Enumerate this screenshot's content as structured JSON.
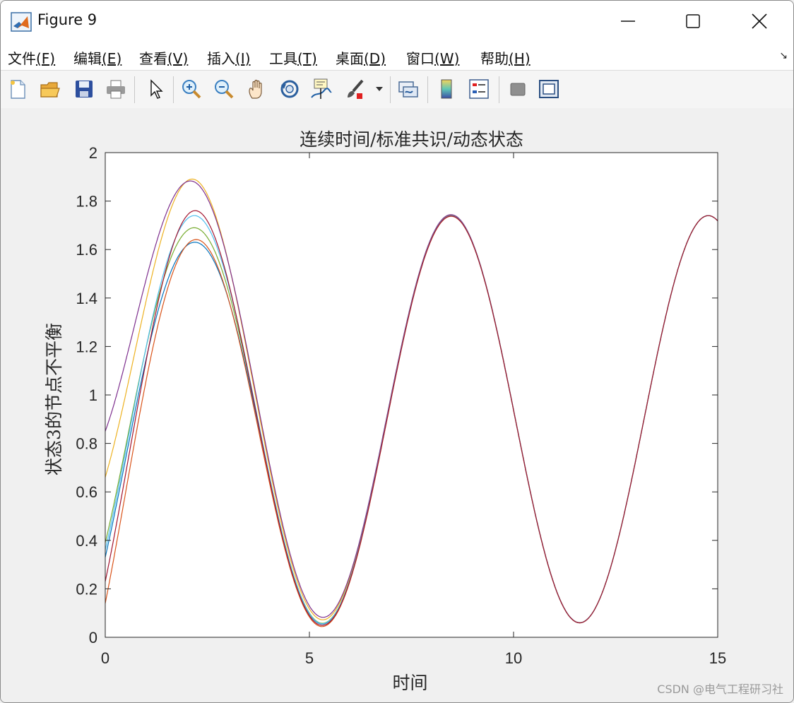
{
  "window": {
    "title": "Figure 9"
  },
  "menu": [
    {
      "label": "文件",
      "mnemonic": "(F)"
    },
    {
      "label": "编辑",
      "mnemonic": "(E)"
    },
    {
      "label": "查看",
      "mnemonic": "(V)"
    },
    {
      "label": "插入",
      "mnemonic": "(I)"
    },
    {
      "label": "工具",
      "mnemonic": "(T)"
    },
    {
      "label": "桌面",
      "mnemonic": "(D)"
    },
    {
      "label": "窗口",
      "mnemonic": "(W)"
    },
    {
      "label": "帮助",
      "mnemonic": "(H)"
    }
  ],
  "menu_overflow_icon": "↘",
  "toolbar": {
    "buttons": [
      "new-figure-icon",
      "open-file-icon",
      "save-icon",
      "print-icon",
      "arrow-cursor-icon",
      "zoom-in-icon",
      "zoom-out-icon",
      "pan-hand-icon",
      "rotate-3d-icon",
      "data-cursor-icon",
      "brush-icon",
      "link-plot-icon",
      "colorbar-icon",
      "legend-icon",
      "hide-plot-tools-icon",
      "show-plot-tools-icon"
    ]
  },
  "watermark": "CSDN @电气工程研习社",
  "chart_data": {
    "type": "line",
    "title": "连续时间/标准共识/动态状态",
    "xlabel": "时间",
    "ylabel": "状态3的节点不平衡",
    "xlim": [
      0,
      15
    ],
    "ylim": [
      0,
      2
    ],
    "xticks": [
      0,
      5,
      10,
      15
    ],
    "yticks": [
      0,
      0.2,
      0.4,
      0.6,
      0.8,
      1,
      1.2,
      1.4,
      1.6,
      1.8,
      2
    ],
    "xtick_labels": [
      "0",
      "5",
      "10",
      "15"
    ],
    "ytick_labels": [
      "0",
      "0.2",
      "0.4",
      "0.6",
      "0.8",
      "1",
      "1.2",
      "1.4",
      "1.6",
      "1.8",
      "2"
    ],
    "grid": false,
    "consensus": {
      "offset": 0.9,
      "amplitude": 0.84,
      "period": 6.3,
      "first_min_t": 5.32
    },
    "series": [
      {
        "color": "#0072BD",
        "initial": 0.33,
        "first_peak": 1.63
      },
      {
        "color": "#D95319",
        "initial": 0.14,
        "first_peak": 1.64
      },
      {
        "color": "#EDB120",
        "initial": 0.66,
        "first_peak": 1.89
      },
      {
        "color": "#7E2F8E",
        "initial": 0.85,
        "first_peak": 1.88
      },
      {
        "color": "#77AC30",
        "initial": 0.39,
        "first_peak": 1.69
      },
      {
        "color": "#4DBEEE",
        "initial": 0.36,
        "first_peak": 1.74
      },
      {
        "color": "#A2142F",
        "initial": 0.23,
        "first_peak": 1.76
      }
    ]
  }
}
